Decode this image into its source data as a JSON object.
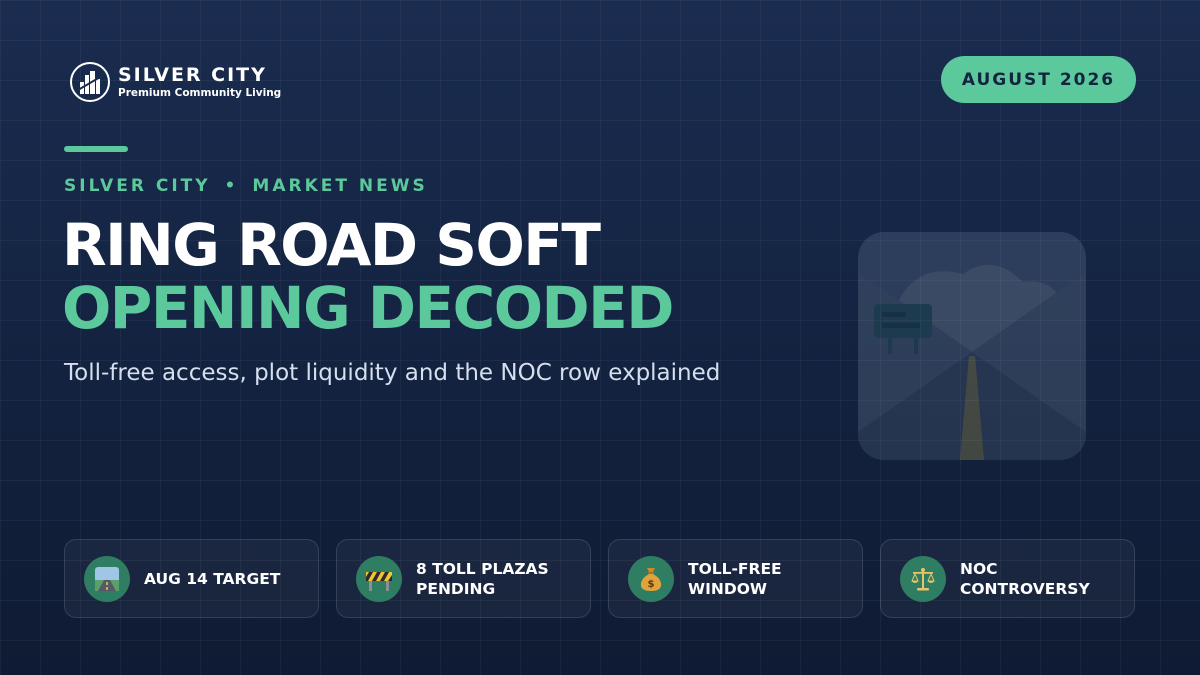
{
  "brand": {
    "name": "SILVER CITY",
    "tagline": "Premium Community Living"
  },
  "date_badge": "AUGUST 2026",
  "kicker": {
    "section": "SILVER CITY",
    "separator": "•",
    "category": "MARKET NEWS"
  },
  "headline": {
    "line1": "RING ROAD SOFT",
    "line2": "OPENING DECODED"
  },
  "subheadline": "Toll-free access, plot liquidity and the NOC row explained",
  "hero_icon": "highway-road-icon",
  "features": [
    {
      "icon": "road-icon",
      "label": "AUG 14 TARGET"
    },
    {
      "icon": "construction-barrier-icon",
      "label": "8 TOLL PLAZAS PENDING"
    },
    {
      "icon": "money-bag-icon",
      "label": "TOLL-FREE WINDOW"
    },
    {
      "icon": "balance-scale-icon",
      "label": "NOC CONTROVERSY"
    }
  ],
  "colors": {
    "background": "#162849",
    "accent": "#5cc99c",
    "icon_circle": "#2f7d62",
    "text": "#ffffff"
  }
}
